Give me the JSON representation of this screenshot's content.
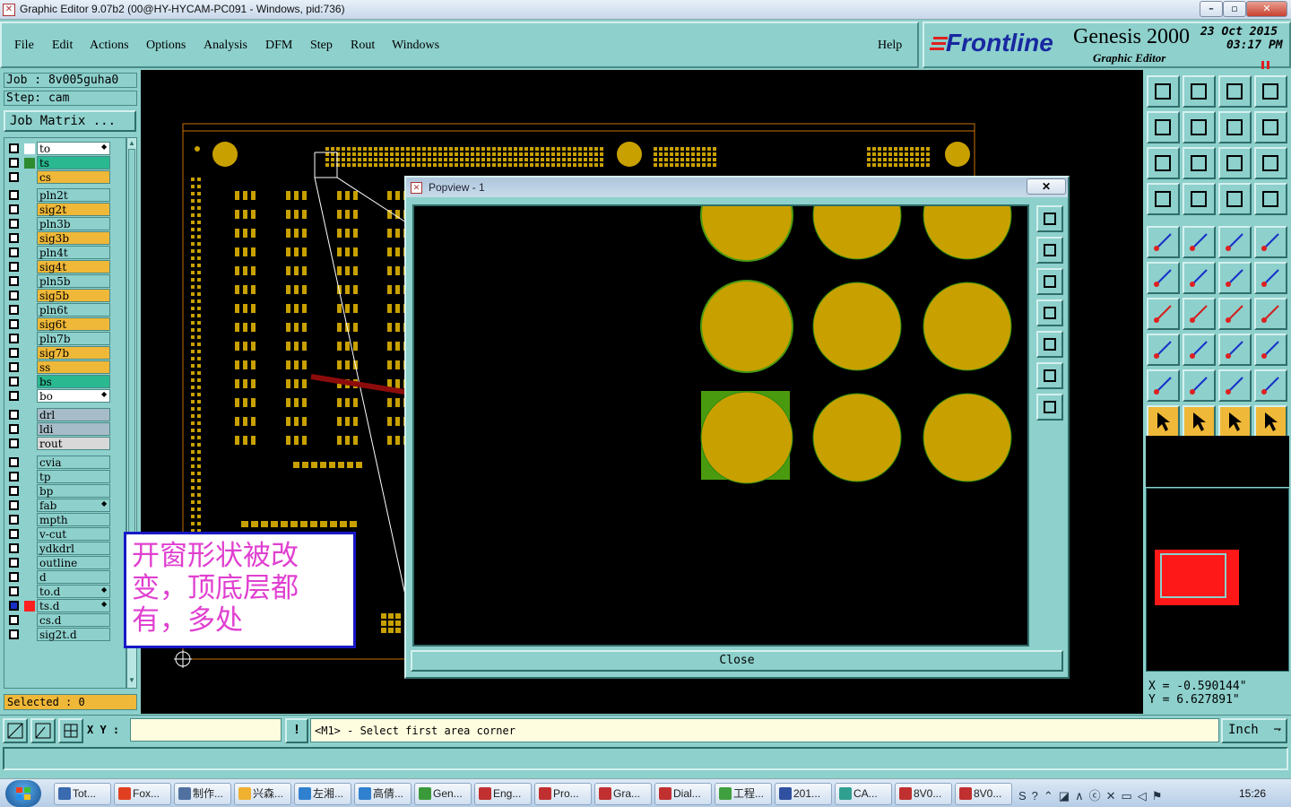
{
  "window": {
    "title": "Graphic Editor 9.07b2 (00@HY-HYCAM-PC091 - Windows, pid:736)"
  },
  "menu": [
    "File",
    "Edit",
    "Actions",
    "Options",
    "Analysis",
    "DFM",
    "Step",
    "Rout",
    "Windows"
  ],
  "help": "Help",
  "brand": {
    "logo": "Frontline",
    "product": "Genesis 2000",
    "subtitle": "Graphic Editor",
    "date": "23 Oct 2015",
    "time": "03:17 PM"
  },
  "job": {
    "job_label": "Job : 8v005guha0",
    "step_label": "Step: cam",
    "matrix_button": "Job Matrix ..."
  },
  "layers": [
    {
      "name": "to",
      "color": "#ffffff",
      "swatch": "#ffffff",
      "mark": true
    },
    {
      "name": "ts",
      "color": "#29b890",
      "swatch": "#2e8b2e"
    },
    {
      "name": "cs",
      "color": "#f0b838",
      "swatch": ""
    },
    {
      "name": "pln2t",
      "color": "#8dd0cc",
      "swatch": ""
    },
    {
      "name": "sig2t",
      "color": "#f0b838",
      "swatch": ""
    },
    {
      "name": "pln3b",
      "color": "#8dd0cc",
      "swatch": ""
    },
    {
      "name": "sig3b",
      "color": "#f0b838",
      "swatch": ""
    },
    {
      "name": "pln4t",
      "color": "#8dd0cc",
      "swatch": ""
    },
    {
      "name": "sig4t",
      "color": "#f0b838",
      "swatch": ""
    },
    {
      "name": "pln5b",
      "color": "#8dd0cc",
      "swatch": ""
    },
    {
      "name": "sig5b",
      "color": "#f0b838",
      "swatch": ""
    },
    {
      "name": "pln6t",
      "color": "#8dd0cc",
      "swatch": ""
    },
    {
      "name": "sig6t",
      "color": "#f0b838",
      "swatch": ""
    },
    {
      "name": "pln7b",
      "color": "#8dd0cc",
      "swatch": ""
    },
    {
      "name": "sig7b",
      "color": "#f0b838",
      "swatch": ""
    },
    {
      "name": "ss",
      "color": "#f0b838",
      "swatch": ""
    },
    {
      "name": "bs",
      "color": "#29b890",
      "swatch": ""
    },
    {
      "name": "bo",
      "color": "#ffffff",
      "swatch": "",
      "mark": true
    },
    {
      "name": "drl",
      "color": "#a6bcc8",
      "swatch": ""
    },
    {
      "name": "ldi",
      "color": "#a6bcc8",
      "swatch": ""
    },
    {
      "name": "rout",
      "color": "#d8d8d8",
      "swatch": ""
    },
    {
      "name": "cvia",
      "color": "#8dd0cc",
      "swatch": ""
    },
    {
      "name": "tp",
      "color": "#8dd0cc",
      "swatch": ""
    },
    {
      "name": "bp",
      "color": "#8dd0cc",
      "swatch": ""
    },
    {
      "name": "fab",
      "color": "#8dd0cc",
      "swatch": "",
      "mark": true
    },
    {
      "name": "mpth",
      "color": "#8dd0cc",
      "swatch": ""
    },
    {
      "name": "v-cut",
      "color": "#8dd0cc",
      "swatch": ""
    },
    {
      "name": "ydkdrl",
      "color": "#8dd0cc",
      "swatch": ""
    },
    {
      "name": "outline",
      "color": "#8dd0cc",
      "swatch": ""
    },
    {
      "name": "d",
      "color": "#8dd0cc",
      "swatch": ""
    },
    {
      "name": "to.d",
      "color": "#8dd0cc",
      "swatch": "",
      "mark": true
    },
    {
      "name": "ts.d",
      "color": "#8dd0cc",
      "swatch": "#ff2020",
      "checked": true,
      "mark": true
    },
    {
      "name": "cs.d",
      "color": "#8dd0cc",
      "swatch": ""
    },
    {
      "name": "sig2t.d",
      "color": "#8dd0cc",
      "swatch": ""
    }
  ],
  "selected": "Selected : 0",
  "annotation": {
    "text": "开窗形状被改变，顶底层都有，多处",
    "color": "#e040d0"
  },
  "popup": {
    "title": "Popview - 1",
    "close_label": "Close"
  },
  "coords": {
    "x": "X = -0.590144\"",
    "y": "Y = 6.627891\""
  },
  "status": {
    "xy_label": "X Y :",
    "xy_value": "",
    "prompt": "<M1> - Select first area corner",
    "units": "Inch"
  },
  "taskbar": {
    "tasks": [
      "Tot...",
      "Fox...",
      "制作...",
      "兴森...",
      "左湘...",
      "高倩...",
      "Gen...",
      "Eng...",
      "Pro...",
      "Gra...",
      "Dial...",
      "工程...",
      "201...",
      "CA...",
      "8V0...",
      "8V0..."
    ],
    "clock": "15:26"
  },
  "colors": {
    "panel": "#8dd0cc",
    "pad": "#c8a000",
    "pad_green": "#4a9a10",
    "highlight": "#f0b838",
    "red": "#ff2020"
  }
}
